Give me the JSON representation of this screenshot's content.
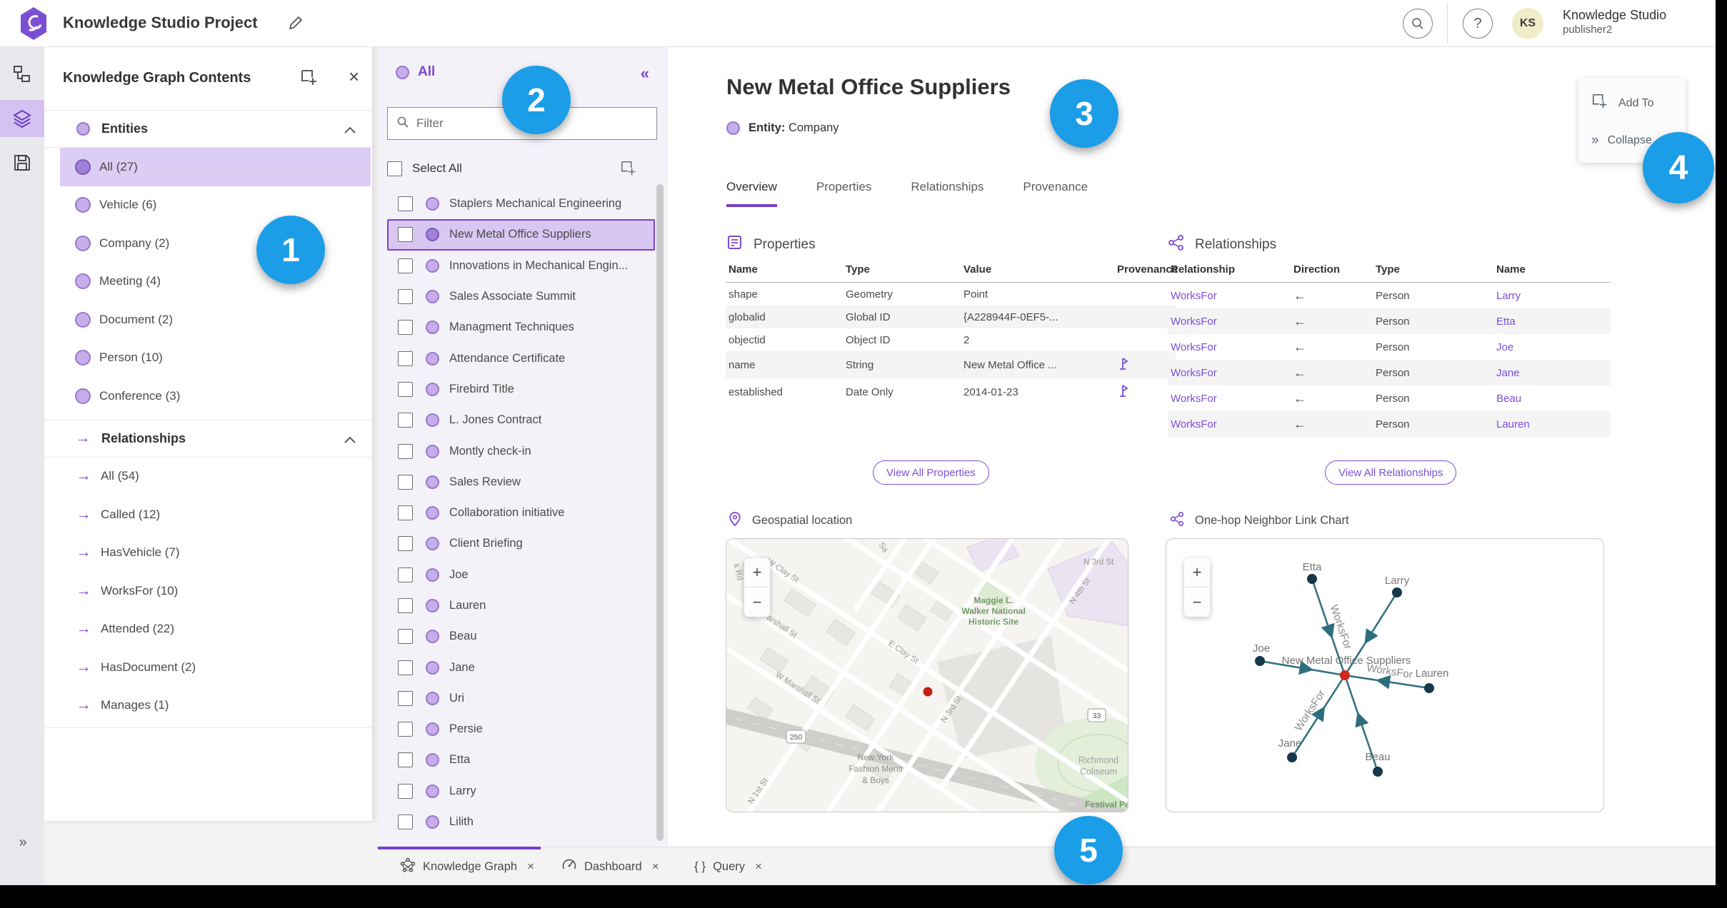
{
  "topbar": {
    "title": "Knowledge Studio Project",
    "avatar_initials": "KS",
    "user_name": "Knowledge Studio",
    "user_role": "publisher2",
    "help_glyph": "?"
  },
  "icons": {
    "close": "×",
    "collapse_left": "«",
    "expand_right": "»",
    "relationship_arrow": "→",
    "query_braces": "{ }"
  },
  "left_panel": {
    "title": "Knowledge Graph Contents",
    "entities": {
      "label": "Entities",
      "items": [
        {
          "label": "All (27)"
        },
        {
          "label": "Vehicle (6)"
        },
        {
          "label": "Company (2)"
        },
        {
          "label": "Meeting (4)"
        },
        {
          "label": "Document (2)"
        },
        {
          "label": "Person (10)"
        },
        {
          "label": "Conference (3)"
        }
      ]
    },
    "relationships": {
      "label": "Relationships",
      "items": [
        {
          "label": "All (54)"
        },
        {
          "label": "Called (12)"
        },
        {
          "label": "HasVehicle (7)"
        },
        {
          "label": "WorksFor (10)"
        },
        {
          "label": "Attended (22)"
        },
        {
          "label": "HasDocument (2)"
        },
        {
          "label": "Manages (1)"
        }
      ]
    }
  },
  "list_panel": {
    "header": "All",
    "filter_placeholder": "Filter",
    "select_all": "Select All",
    "items": [
      "Staplers Mechanical Engineering",
      "New Metal Office Suppliers",
      "Innovations in Mechanical Engin...",
      "Sales Associate Summit",
      "Managment Techniques",
      "Attendance Certificate",
      "Firebird Title",
      "L. Jones Contract",
      "Montly check-in",
      "Sales Review",
      "Collaboration initiative",
      "Client Briefing",
      "Joe",
      "Lauren",
      "Beau",
      "Jane",
      "Uri",
      "Persie",
      "Etta",
      "Larry",
      "Lilith"
    ]
  },
  "detail": {
    "title": "New Metal Office Suppliers",
    "entity_label": "Entity:",
    "entity_type": "Company",
    "tabs": [
      "Overview",
      "Properties",
      "Relationships",
      "Provenance"
    ],
    "properties": {
      "heading": "Properties",
      "columns": [
        "Name",
        "Type",
        "Value",
        "Provenance"
      ],
      "rows": [
        [
          "shape",
          "Geometry",
          "Point",
          ""
        ],
        [
          "globalid",
          "Global ID",
          "{A228944F-0EF5-...",
          ""
        ],
        [
          "objectid",
          "Object ID",
          "2",
          ""
        ],
        [
          "name",
          "String",
          "New Metal Office ...",
          "flag-icon"
        ],
        [
          "established",
          "Date Only",
          "2014-01-23",
          "flag-icon"
        ]
      ],
      "view_all": "View All Properties"
    },
    "relationships": {
      "heading": "Relationships",
      "columns": [
        "Relationship",
        "Direction",
        "Type",
        "Name"
      ],
      "rows": [
        [
          "WorksFor",
          "←",
          "Person",
          "Larry"
        ],
        [
          "WorksFor",
          "←",
          "Person",
          "Etta"
        ],
        [
          "WorksFor",
          "←",
          "Person",
          "Joe"
        ],
        [
          "WorksFor",
          "←",
          "Person",
          "Jane"
        ],
        [
          "WorksFor",
          "←",
          "Person",
          "Beau"
        ],
        [
          "WorksFor",
          "←",
          "Person",
          "Lauren"
        ]
      ],
      "view_all": "View All Relationships"
    },
    "geo_heading": "Geospatial location",
    "linkchart_heading": "One-hop Neighbor Link Chart"
  },
  "map": {
    "zoom_in": "+",
    "zoom_out": "−",
    "shields": [
      "250",
      "33"
    ],
    "labels": [
      "k Rd",
      "W Clay St",
      "Sa",
      "N 3rd St",
      "N 4th St",
      "Maggie L.",
      "Walker National",
      "Historic Site",
      "arshall St",
      "E Clay St",
      "W Marshall St",
      "N 3rd St",
      "New York",
      "Fashion Mens",
      "& Boys",
      "Richmond",
      "Coliseum",
      "N 1st St",
      "Festival Park"
    ]
  },
  "link_chart": {
    "zoom_in": "+",
    "zoom_out": "−",
    "center": "New Metal Office Suppliers",
    "edge_label": "WorksFor",
    "nodes": [
      "Etta",
      "Larry",
      "Joe",
      "Lauren",
      "Jane",
      "Beau"
    ],
    "node_color": "#17374d",
    "edge_color": "#2e6d7e",
    "center_color": "#cf2a1b"
  },
  "overlay": {
    "add_to": "Add To",
    "collapse": "Collapse"
  },
  "bottom_tabs": [
    {
      "label": "Knowledge Graph"
    },
    {
      "label": "Dashboard"
    },
    {
      "label": "Query"
    }
  ],
  "callouts": [
    "1",
    "2",
    "3",
    "4",
    "5"
  ],
  "colors": {
    "accent_purple": "#7a4ad1",
    "selection_bg": "#d9c7f3",
    "selection_border": "#7b40d0",
    "callout_blue": "#1b9de8",
    "link_purple": "#7a4fd8"
  }
}
